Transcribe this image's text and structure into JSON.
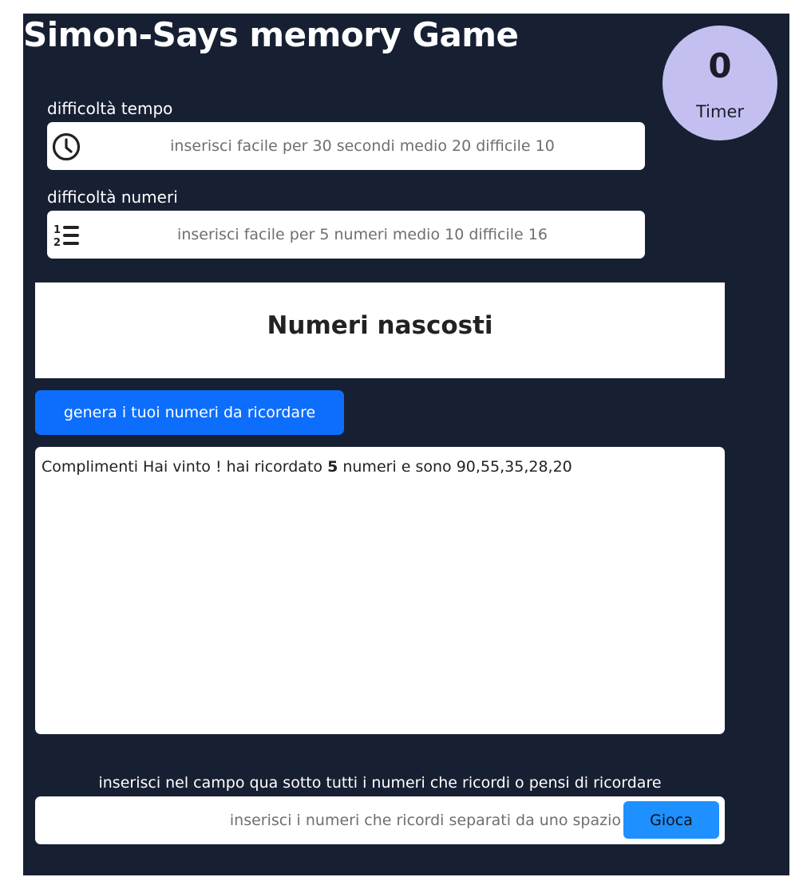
{
  "app": {
    "title": "Simon-Says memory Game"
  },
  "timer": {
    "value": "0",
    "label": "Timer"
  },
  "time_difficulty": {
    "label": "difficoltà tempo",
    "placeholder": "inserisci facile per 30 secondi medio 20 difficile 10",
    "icon": "clock-icon"
  },
  "number_difficulty": {
    "label": "difficoltà numeri",
    "placeholder": "inserisci facile per 5 numeri medio 10 difficile 16",
    "icon": "numbered-list-icon"
  },
  "hidden_numbers": {
    "title": "Numeri nascosti"
  },
  "generate_button": {
    "label": "genera i tuoi numeri da ricordare"
  },
  "result": {
    "prefix": "Complimenti Hai vinto ! hai ricordato ",
    "count": "5",
    "suffix": " numeri e sono 90,55,35,28,20"
  },
  "answer": {
    "label": "inserisci nel campo qua sotto tutti i numeri che ricordi o pensi di ricordare",
    "placeholder": "inserisci i numeri che ricordi separati da uno spazio",
    "play_label": "Gioca"
  },
  "colors": {
    "background": "#172033",
    "primary_button": "#0d6efd",
    "play_button": "#1e90ff",
    "timer_circle": "#c3c0f1"
  }
}
